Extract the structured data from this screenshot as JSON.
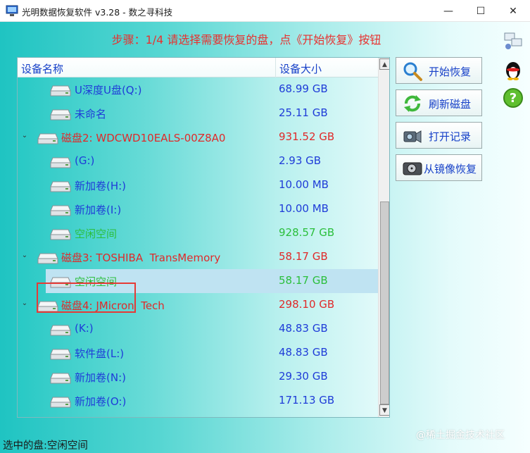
{
  "window": {
    "title": "光明数据恢复软件 v3.28 - 数之寻科技",
    "minimize_glyph": "—",
    "maximize_glyph": "☐",
    "close_glyph": "✕"
  },
  "step_text": "步骤：1/4 请选择需要恢复的盘，点《开始恢复》按钮",
  "list": {
    "headers": {
      "name": "设备名称",
      "size": "设备大小"
    },
    "rows": [
      {
        "name": "U深度U盘(Q:)",
        "size": "68.99 GB",
        "level": 2,
        "color": "blue"
      },
      {
        "name": "未命名",
        "size": "25.11 GB",
        "level": 2,
        "color": "blue"
      },
      {
        "name": "磁盘2: WDCWD10EALS-00Z8A0",
        "size": "931.52 GB",
        "level": 1,
        "color": "red",
        "expanded": true
      },
      {
        "name": "(G:)",
        "size": "2.93 GB",
        "level": 2,
        "color": "blue"
      },
      {
        "name": "新加卷(H:)",
        "size": "10.00 MB",
        "level": 2,
        "color": "blue"
      },
      {
        "name": "新加卷(I:)",
        "size": "10.00 MB",
        "level": 2,
        "color": "blue"
      },
      {
        "name": "空闲空间",
        "size": "928.57 GB",
        "level": 2,
        "color": "green"
      },
      {
        "name": "磁盘3: TOSHIBA  TransMemory",
        "size": "58.17 GB",
        "level": 1,
        "color": "red",
        "expanded": true
      },
      {
        "name": "空闲空间",
        "size": "58.17 GB",
        "level": 2,
        "color": "green",
        "selected": true
      },
      {
        "name": "磁盘4: JMicron  Tech",
        "size": "298.10 GB",
        "level": 1,
        "color": "red",
        "expanded": true
      },
      {
        "name": "(K:)",
        "size": "48.83 GB",
        "level": 2,
        "color": "blue"
      },
      {
        "name": "软件盘(L:)",
        "size": "48.83 GB",
        "level": 2,
        "color": "blue"
      },
      {
        "name": "新加卷(N:)",
        "size": "29.30 GB",
        "level": 2,
        "color": "blue"
      },
      {
        "name": "新加卷(O:)",
        "size": "171.13 GB",
        "level": 2,
        "color": "blue"
      }
    ],
    "expander_glyph": "⌄",
    "scroll_up_glyph": "▲",
    "scroll_down_glyph": "▼"
  },
  "buttons": {
    "start_recovery": "开始恢复",
    "refresh_disk": "刷新磁盘",
    "open_record": "打开记录",
    "restore_from_image": "从镜像恢复"
  },
  "status_text": "选中的盘:空闲空间",
  "watermark": "@稀土掘金技术社区",
  "colors": {
    "blue": "#1f3cd8",
    "red": "#e02a2a",
    "green": "#2bbf3c",
    "step_red": "#e8312f",
    "highlight_border": "#e63a36"
  },
  "icons": {
    "app": "app-icon",
    "disk": "hard-disk-icon",
    "start": "magnifier-icon",
    "refresh": "refresh-icon",
    "record": "camera-icon",
    "image": "disk-drive-icon",
    "network": "network-icon",
    "qq": "qq-penguin-icon",
    "help": "help-icon"
  }
}
